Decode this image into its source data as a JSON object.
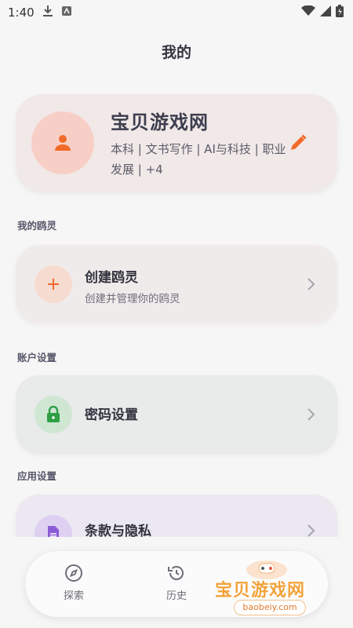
{
  "status_bar": {
    "time": "1:40"
  },
  "page": {
    "title": "我的"
  },
  "profile": {
    "name": "宝贝游戏网",
    "tags": "本科 | 文书写作 | AI与科技 | 职业发展 | +4"
  },
  "sections": {
    "my_agents": {
      "label": "我的鸥灵",
      "create": {
        "title": "创建鸥灵",
        "subtitle": "创建并管理你的鸥灵"
      }
    },
    "account": {
      "label": "账户设置",
      "password": {
        "title": "密码设置"
      }
    },
    "app": {
      "label": "应用设置",
      "terms": {
        "title": "条款与隐私"
      }
    }
  },
  "bottom_nav": {
    "items": [
      {
        "label": "探索",
        "icon": "compass-icon"
      },
      {
        "label": "历史",
        "icon": "history-icon"
      }
    ]
  },
  "watermark": {
    "text": "宝贝游戏网",
    "url": "baobeiy.com"
  },
  "colors": {
    "accent_orange": "#f26a2a",
    "lock_green": "#2f9e44",
    "terms_purple": "#8c5bd6"
  }
}
